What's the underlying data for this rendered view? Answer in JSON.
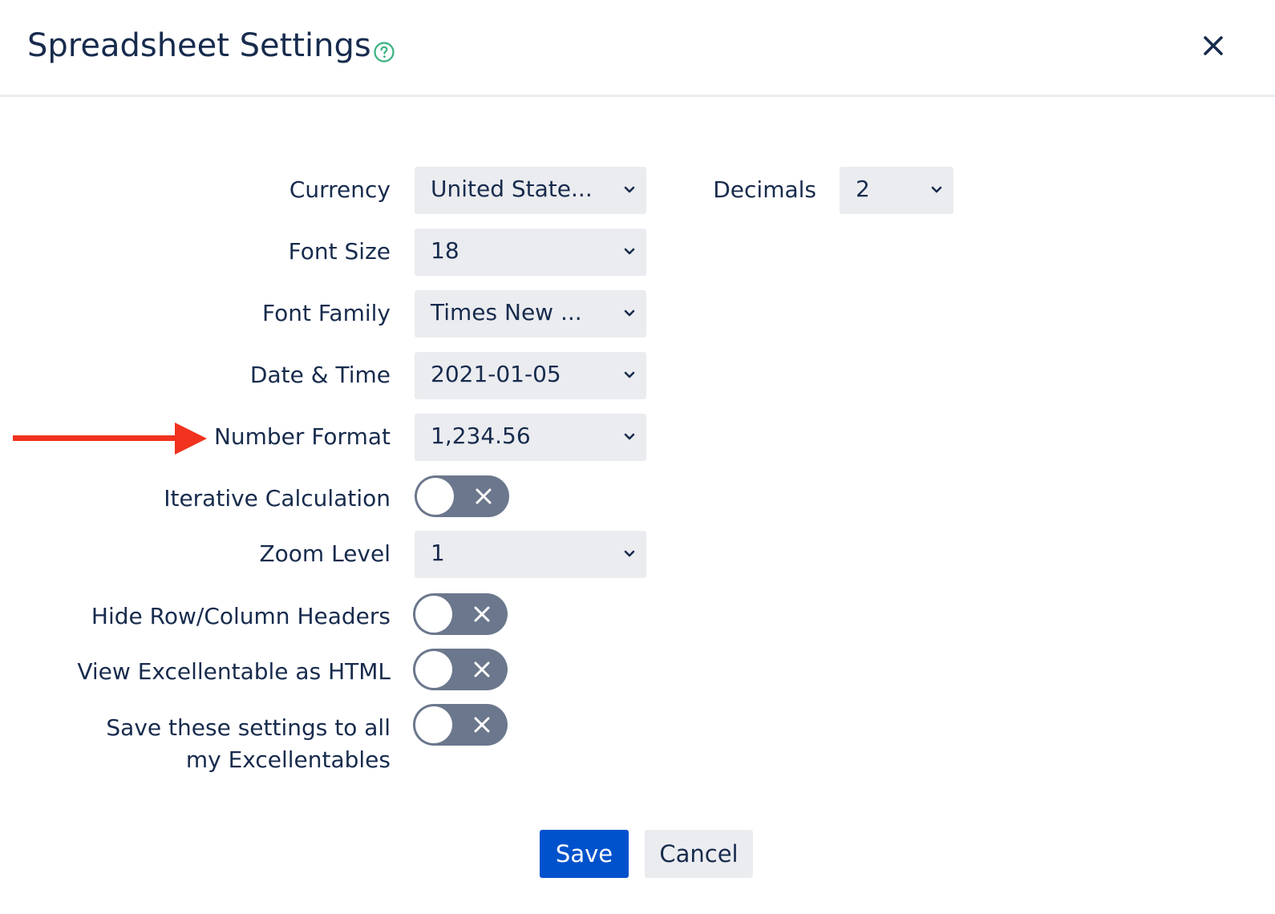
{
  "dialog": {
    "title": "Spreadsheet Settings",
    "help_icon": "question-circle-icon",
    "close_icon": "close-icon"
  },
  "settings": {
    "currency": {
      "label": "Currency",
      "value": "United State..."
    },
    "decimals": {
      "label": "Decimals",
      "value": "2"
    },
    "font_size": {
      "label": "Font Size",
      "value": "18"
    },
    "font_family": {
      "label": "Font Family",
      "value": "Times New ..."
    },
    "date_time": {
      "label": "Date & Time",
      "value": "2021-01-05"
    },
    "number_format": {
      "label": "Number Format",
      "value": "1,234.56"
    },
    "iterative_calculation": {
      "label": "Iterative Calculation",
      "enabled": false
    },
    "zoom_level": {
      "label": "Zoom Level",
      "value": "1"
    },
    "hide_headers": {
      "label": "Hide Row/Column Headers",
      "enabled": false
    },
    "view_as_html": {
      "label": "View Excellentable as HTML",
      "enabled": false
    },
    "save_to_all": {
      "label_line1": "Save these settings to all",
      "label_line2": "my Excellentables",
      "enabled": false
    }
  },
  "annotation": {
    "arrow_color": "#f0321e",
    "arrow_icon": "right-arrow-icon"
  },
  "buttons": {
    "save": "Save",
    "cancel": "Cancel"
  },
  "colors": {
    "primary": "#0052cc",
    "text": "#172b4d",
    "field_bg": "#ebecf0",
    "toggle_off": "#6b778c",
    "help": "#36b37e"
  }
}
